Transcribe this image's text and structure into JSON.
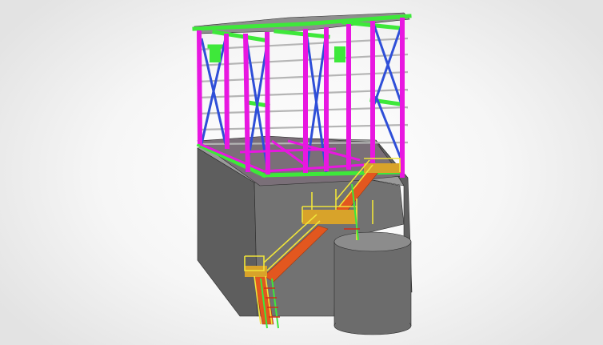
{
  "viewport": {
    "background": "#f4f4f4",
    "model": {
      "concrete_color": "#6f6f6f",
      "concrete_dark": "#565656",
      "concrete_light": "#8a8a8a",
      "column_color": "#e817e0",
      "bracing_color": "#2f4fd8",
      "beam_color": "#3ee83a",
      "purlin_color": "#b9b9b9",
      "stair_color": "#e2571f",
      "handrail_color": "#f0e43a",
      "edge_color": "#2a2a2a"
    }
  }
}
